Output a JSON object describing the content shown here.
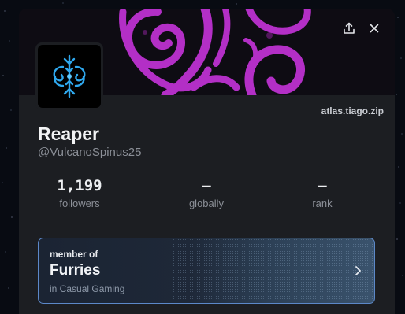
{
  "profile": {
    "display_name": "Reaper",
    "username": "@VulcanoSpinus25",
    "site_link": "atlas.tiago.zip",
    "avatar_icon": "snowflake-emblem-icon",
    "banner_icon": "purple-swirl-banner",
    "accent_color": "#b32fc6"
  },
  "actions": {
    "share_icon": "share-icon",
    "close_icon": "close-icon"
  },
  "stats": [
    {
      "value": "1,199",
      "label": "followers"
    },
    {
      "value": "–",
      "label": "globally"
    },
    {
      "value": "–",
      "label": "rank"
    }
  ],
  "group": {
    "kicker": "member of",
    "name": "Furries",
    "category": "in Casual Gaming",
    "chevron_icon": "chevron-right-icon",
    "border_color": "#5c88c8"
  }
}
